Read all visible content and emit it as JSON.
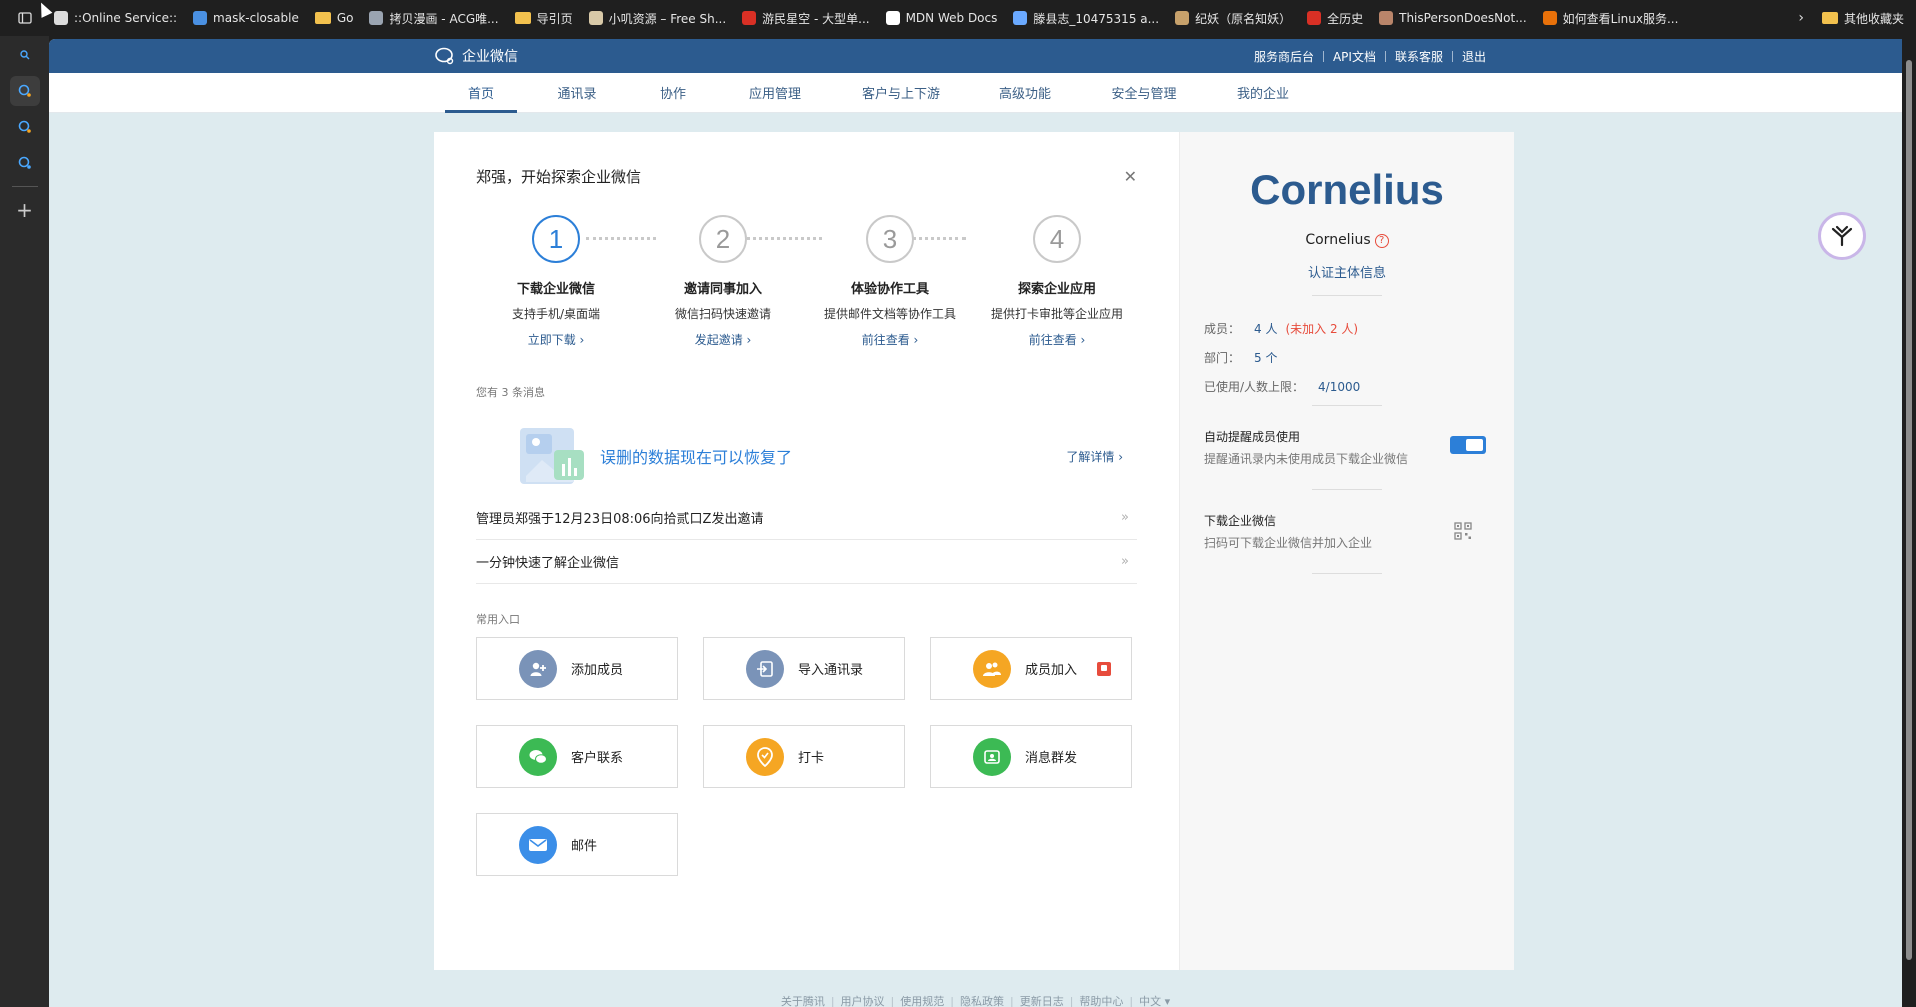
{
  "bookmarks": [
    {
      "label": "::Online Service::",
      "color": "#dddddd",
      "kind": "doc"
    },
    {
      "label": "mask-closable",
      "color": "#4a90e2",
      "kind": "vue"
    },
    {
      "label": "Go",
      "color": "#f2c14e",
      "kind": "folder"
    },
    {
      "label": "拷贝漫画 - ACG唯...",
      "color": "#9aa4b1",
      "kind": "img"
    },
    {
      "label": "导引页",
      "color": "#f2c14e",
      "kind": "folder"
    },
    {
      "label": "小叽资源 – Free Sh...",
      "color": "#d8c9a8",
      "kind": "img"
    },
    {
      "label": "游民星空 - 大型单...",
      "color": "#d93025",
      "kind": "img"
    },
    {
      "label": "MDN Web Docs",
      "color": "#ffffff",
      "kind": "mdn"
    },
    {
      "label": "滕县志_10475315 a...",
      "color": "#6aa9ff",
      "kind": "img"
    },
    {
      "label": "纪妖（原名知妖）",
      "color": "#c7a16b",
      "kind": "img"
    },
    {
      "label": "全历史",
      "color": "#d93025",
      "kind": "img"
    },
    {
      "label": "ThisPersonDoesNot...",
      "color": "#b9856a",
      "kind": "img"
    },
    {
      "label": "如何查看Linux服务...",
      "color": "#e8710a",
      "kind": "img"
    }
  ],
  "other_bookmarks": "其他收藏夹",
  "brand": "企业微信",
  "top_links": [
    "服务商后台",
    "API文档",
    "联系客服",
    "退出"
  ],
  "nav": [
    {
      "label": "首页",
      "width": 72
    },
    {
      "label": "通讯录",
      "width": 120
    },
    {
      "label": "协作",
      "width": 72
    },
    {
      "label": "应用管理",
      "width": 132
    },
    {
      "label": "客户与上下游",
      "width": 120
    },
    {
      "label": "高级功能",
      "width": 128
    },
    {
      "label": "安全与管理",
      "width": 110
    },
    {
      "label": "我的企业",
      "width": 128
    }
  ],
  "welcome": "郑强，开始探索企业微信",
  "steps": [
    {
      "num": "1",
      "title": "下载企业微信",
      "desc": "支持手机/桌面端",
      "link": "立即下载 ›"
    },
    {
      "num": "2",
      "title": "邀请同事加入",
      "desc": "微信扫码快速邀请",
      "link": "发起邀请 ›"
    },
    {
      "num": "3",
      "title": "体验协作工具",
      "desc": "提供邮件文档等协作工具",
      "link": "前往查看 ›"
    },
    {
      "num": "4",
      "title": "探索企业应用",
      "desc": "提供打卡审批等企业应用",
      "link": "前往查看 ›"
    }
  ],
  "messages_count": "您有 3 条消息",
  "promo": {
    "title": "误删的数据现在可以恢复了",
    "more": "了解详情 ›"
  },
  "message_rows": [
    {
      "text": "管理员郑强于12月23日08:06向拾贰口Z发出邀请",
      "arrow": "»"
    },
    {
      "text": "一分钟快速了解企业微信",
      "arrow": "»"
    }
  ],
  "common_label": "常用入口",
  "tiles": [
    {
      "label": "添加成员",
      "color": "#7a93b8",
      "icon": "add-user-icon"
    },
    {
      "label": "导入通讯录",
      "color": "#7a93b8",
      "icon": "import-icon"
    },
    {
      "label": "成员加入",
      "color": "#f5a623",
      "icon": "members-icon"
    },
    {
      "label": "客户联系",
      "color": "#3cba54",
      "icon": "wechat-icon"
    },
    {
      "label": "打卡",
      "color": "#f5a623",
      "icon": "location-icon"
    },
    {
      "label": "消息群发",
      "color": "#3cba54",
      "icon": "broadcast-icon"
    },
    {
      "label": "邮件",
      "color": "#3b8ee8",
      "icon": "mail-icon"
    }
  ],
  "corp": {
    "logo_text": "Cornelius",
    "name": "Cornelius",
    "help": "?",
    "verify": "认证主体信息"
  },
  "stats": {
    "members_label": "成员：",
    "members_value": "4 人",
    "members_pending": "(未加入 2 人)",
    "depts_label": "部门：",
    "depts_value": "5 个",
    "usage_label": "已使用/人数上限：",
    "usage_value": "4/1000"
  },
  "auto_remind": {
    "title": "自动提醒成员使用",
    "desc": "提醒通讯录内未使用成员下载企业微信",
    "enabled": true
  },
  "download": {
    "title": "下载企业微信",
    "desc": "扫码可下载企业微信并加入企业"
  },
  "footer": [
    "关于腾讯",
    "用户协议",
    "使用规范",
    "隐私政策",
    "更新日志",
    "帮助中心",
    "中文 ▾"
  ]
}
